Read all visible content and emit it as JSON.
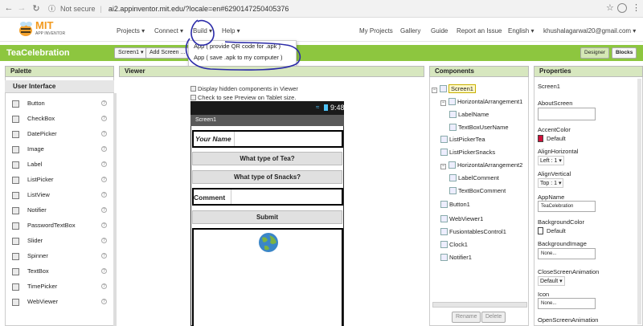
{
  "browser": {
    "back_icon": "arrow-left-icon",
    "forward_icon": "arrow-right-icon",
    "reload_icon": "reload-icon",
    "security": "Not secure",
    "url": "ai2.appinventor.mit.edu/?locale=en#6290147250405376",
    "star_icon": "star-icon",
    "menu_icon": "kebab-icon"
  },
  "brand": {
    "mit": "MIT",
    "sub": "APP INVENTOR"
  },
  "topnav": {
    "projects": "Projects ▾",
    "connect": "Connect ▾",
    "build": "Build ▾",
    "help": "Help ▾",
    "my_projects": "My Projects",
    "gallery": "Gallery",
    "guide": "Guide",
    "report": "Report an Issue",
    "language": "English ▾",
    "account": "khushalagarwal20@gmail.com ▾"
  },
  "build_menu": {
    "items": [
      "App ( provide QR code for .apk )",
      "App ( save .apk to my computer )"
    ]
  },
  "project": {
    "name": "TeaCelebration",
    "screen_select": "Screen1 ▾",
    "add_screen": "Add Screen ...",
    "designer": "Designer",
    "blocks": "Blocks"
  },
  "palette": {
    "title": "Palette",
    "section": "User Interface",
    "help_glyph": "?",
    "items": [
      "Button",
      "CheckBox",
      "DatePicker",
      "Image",
      "Label",
      "ListPicker",
      "ListView",
      "Notifier",
      "PasswordTextBox",
      "Slider",
      "Spinner",
      "TextBox",
      "TimePicker",
      "WebViewer"
    ]
  },
  "viewer": {
    "title": "Viewer",
    "show_hidden": "Display hidden components in Viewer",
    "tablet": "Check to see Preview on Tablet size.",
    "time": "9:48",
    "screen_title": "Screen1",
    "your_name": "Your Name",
    "tea_btn": "What type of Tea?",
    "snacks_btn": "What type of Snacks?",
    "comment": "Comment",
    "submit": "Submit"
  },
  "components": {
    "title": "Components",
    "tree": [
      {
        "label": "Screen1",
        "depth": 0
      },
      {
        "label": "HorizontalArrangement1",
        "depth": 1
      },
      {
        "label": "LabelName",
        "depth": 2
      },
      {
        "label": "TextBoxUserName",
        "depth": 2
      },
      {
        "label": "ListPickerTea",
        "depth": 1
      },
      {
        "label": "ListPickerSnacks",
        "depth": 1
      },
      {
        "label": "HorizontalArrangement2",
        "depth": 1
      },
      {
        "label": "LabelComment",
        "depth": 2
      },
      {
        "label": "TextBoxComment",
        "depth": 2
      },
      {
        "label": "Button1",
        "depth": 1
      },
      {
        "label": "WebViewer1",
        "depth": 1
      },
      {
        "label": "FusiontablesControl1",
        "depth": 1
      },
      {
        "label": "Clock1",
        "depth": 1
      },
      {
        "label": "Notifier1",
        "depth": 1
      }
    ],
    "rename": "Rename",
    "delete": "Delete"
  },
  "properties": {
    "title": "Properties",
    "component": "Screen1",
    "about_label": "AboutScreen",
    "accent_label": "AccentColor",
    "accent_value": "Default",
    "accent_color": "#d0103a",
    "align_h_label": "AlignHorizontal",
    "align_h_value": "Left : 1 ▾",
    "align_v_label": "AlignVertical",
    "align_v_value": "Top : 1 ▾",
    "appname_label": "AppName",
    "appname_value": "TeaCelebration",
    "bg_label": "BackgroundColor",
    "bg_value": "Default",
    "bgimg_label": "BackgroundImage",
    "bgimg_value": "None...",
    "close_anim_label": "CloseScreenAnimation",
    "close_anim_value": "Default ▾",
    "icon_label": "Icon",
    "icon_value": "None...",
    "open_anim_label": "OpenScreenAnimation"
  },
  "colors": {
    "brand_green": "#8dc63f",
    "panel_header": "#d7e7bf",
    "annotation": "#2a2aa8"
  }
}
